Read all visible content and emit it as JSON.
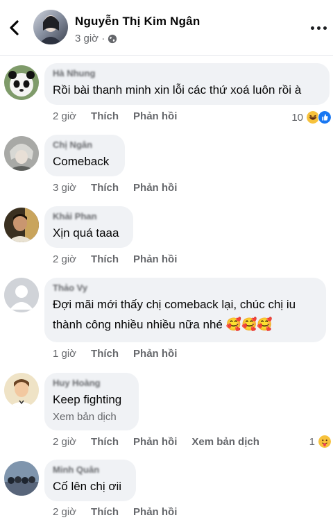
{
  "post": {
    "author": "Nguyễn Thị Kim Ngân",
    "time": "3 giờ ·"
  },
  "labels": {
    "like": "Thích",
    "reply": "Phản hồi",
    "see_translation": "Xem bản dịch"
  },
  "comments": [
    {
      "author": "Hà Nhung",
      "text": "Rồi bài thanh minh xin lỗi các thứ xoá luôn rồi à",
      "time": "2 giờ",
      "reaction_count": "10",
      "reactions": [
        "haha-icon",
        "like-icon"
      ]
    },
    {
      "author": "Chị Ngân",
      "text": "Comeback",
      "time": "3 giờ"
    },
    {
      "author": "Khải Phan",
      "text": "Xịn quá taaa",
      "time": "2 giờ"
    },
    {
      "author": "Thảo Vy",
      "text_line1": "Đợi mãi mới thấy chị comeback lại, chúc chị iu",
      "text_line2": "thành công nhiều nhiều nữa nhé",
      "emojis": "🥰🥰🥰",
      "time": "1 giờ"
    },
    {
      "author": "Huy Hoàng",
      "text": "Keep fighting",
      "time": "2 giờ",
      "reaction_count": "1",
      "reactions": [
        "care-icon"
      ]
    },
    {
      "author": "Minh Quân",
      "text": "Cố lên chị ơii",
      "time": "2 giờ"
    }
  ]
}
